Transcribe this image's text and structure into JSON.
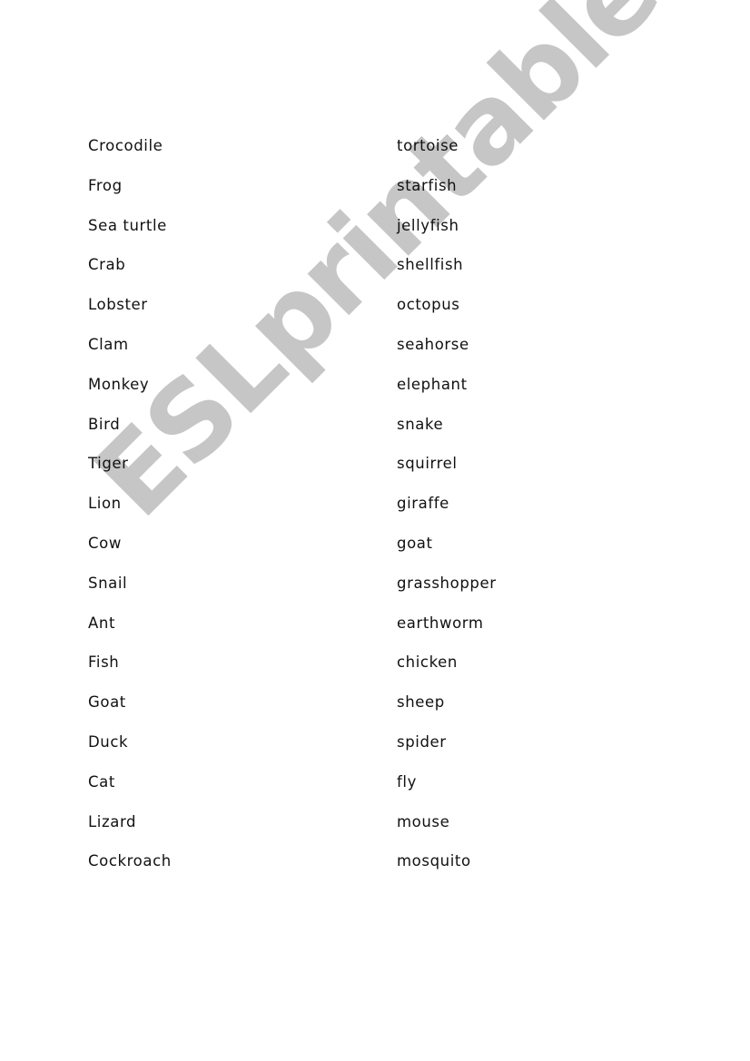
{
  "watermark": "ESLprintables.com",
  "worksheet": {
    "left_column": [
      "Crocodile",
      "Frog",
      "Sea turtle",
      "Crab",
      "Lobster",
      "Clam",
      "Monkey",
      "Bird",
      "Tiger",
      "Lion",
      "Cow",
      "Snail",
      "Ant",
      "Fish",
      "Goat",
      "Duck",
      "Cat",
      "Lizard",
      "Cockroach"
    ],
    "right_column": [
      "tortoise",
      "starfish",
      "jellyfish",
      "shellfish",
      "octopus",
      "seahorse",
      "elephant",
      "snake",
      "squirrel",
      "giraffe",
      "goat",
      "grasshopper",
      "earthworm",
      "chicken",
      "sheep",
      "spider",
      "fly",
      "mouse",
      "mosquito"
    ]
  },
  "colors": {
    "text": "#111111",
    "watermark": "#c4c4c4",
    "background": "#ffffff"
  }
}
